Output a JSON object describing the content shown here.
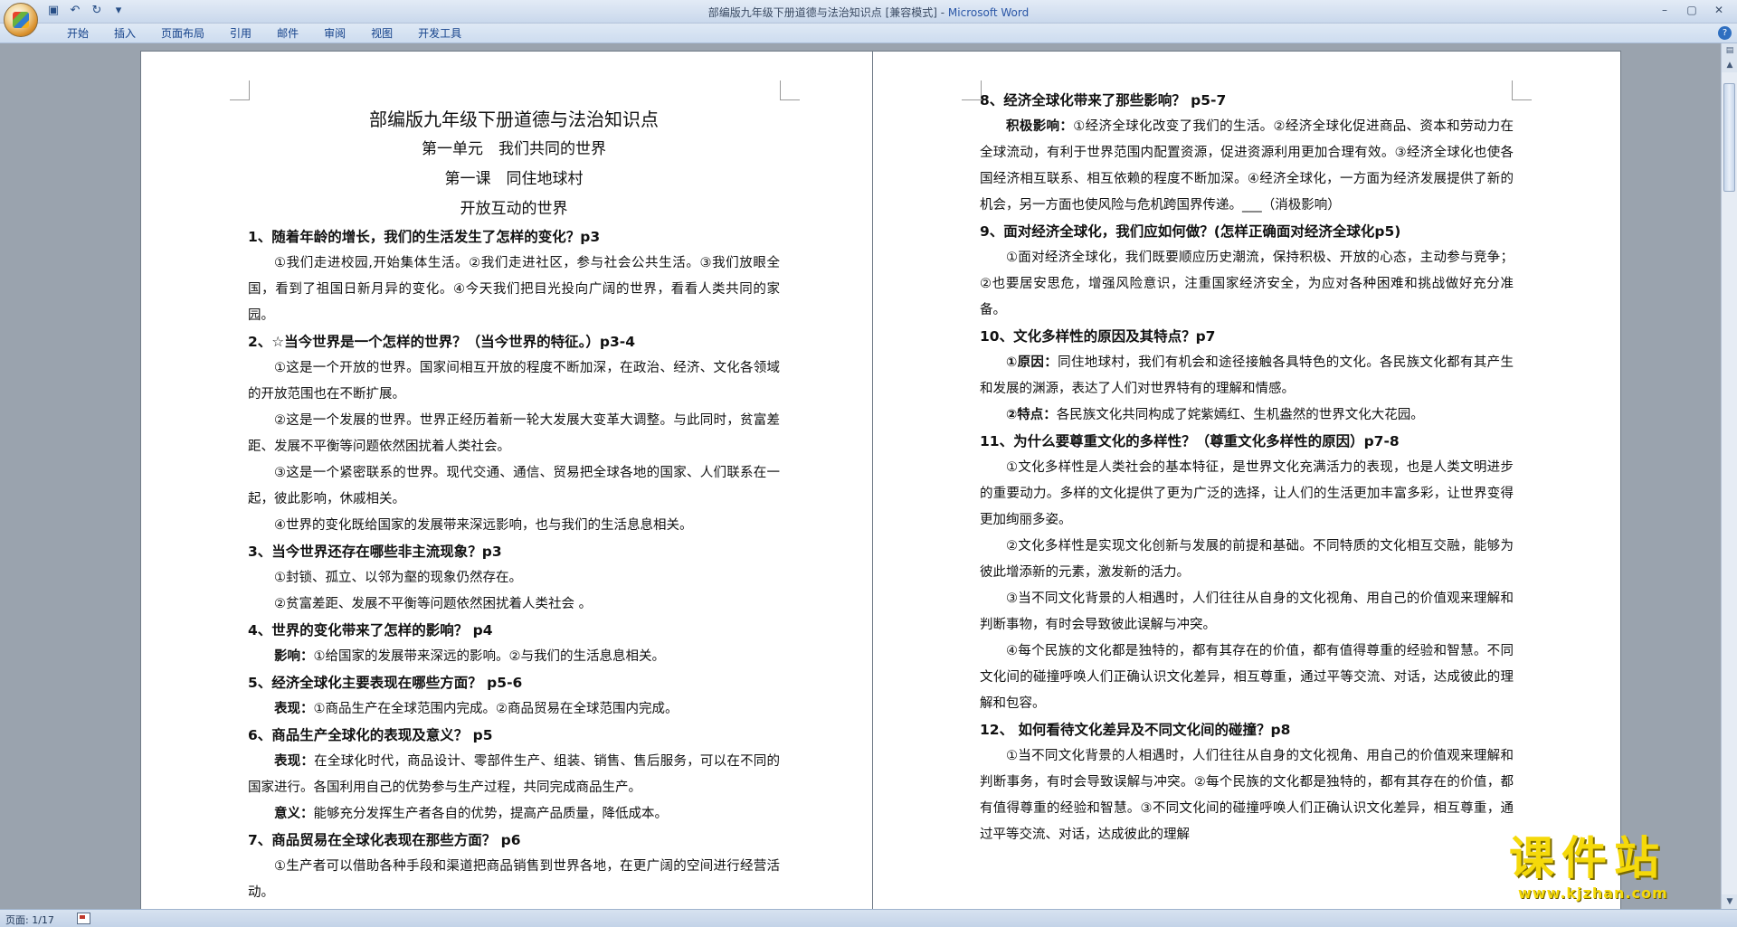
{
  "titlebar": {
    "doc_title": "部编版九年级下册道德与法治知识点 [兼容模式] - ",
    "app_name": "Microsoft Word",
    "qat": [
      "save-icon",
      "undo-icon",
      "redo-icon",
      "customize-icon"
    ],
    "window_controls": [
      "minimize-icon",
      "maximize-icon",
      "close-icon"
    ]
  },
  "ribbon": {
    "tabs": [
      "开始",
      "插入",
      "页面布局",
      "引用",
      "邮件",
      "审阅",
      "视图",
      "开发工具"
    ]
  },
  "left_page": {
    "title": "部编版九年级下册道德与法治知识点",
    "unit": "第一单元　我们共同的世界",
    "lesson": "第一课　同住地球村",
    "section": "开放互动的世界",
    "blocks": [
      {
        "type": "q",
        "text": "1、随着年龄的增长，我们的生活发生了怎样的变化？p3"
      },
      {
        "type": "p",
        "text": "①我们走进校园,开始集体生活。②我们走进社区，参与社会公共生活。③我们放眼全国，看到了祖国日新月异的变化。④今天我们把目光投向广阔的世界，看看人类共同的家园。"
      },
      {
        "type": "q",
        "text": "2、☆当今世界是一个怎样的世界？（当今世界的特征。）p3-4"
      },
      {
        "type": "p",
        "text": "①这是一个开放的世界。国家间相互开放的程度不断加深，在政治、经济、文化各领域的开放范围也在不断扩展。"
      },
      {
        "type": "p",
        "text": "②这是一个发展的世界。世界正经历着新一轮大发展大变革大调整。与此同时，贫富差距、发展不平衡等问题依然困扰着人类社会。"
      },
      {
        "type": "p",
        "text": "③这是一个紧密联系的世界。现代交通、通信、贸易把全球各地的国家、人们联系在一起，彼此影响，休戚相关。"
      },
      {
        "type": "p",
        "text": "④世界的变化既给国家的发展带来深远影响，也与我们的生活息息相关。"
      },
      {
        "type": "q",
        "text": "3、当今世界还存在哪些非主流现象？p3"
      },
      {
        "type": "p",
        "text": "①封锁、孤立、以邻为壑的现象仍然存在。"
      },
      {
        "type": "p",
        "text": "②贫富差距、发展不平衡等问题依然困扰着人类社会 。"
      },
      {
        "type": "q",
        "text": "4、世界的变化带来了怎样的影响？ p4"
      },
      {
        "type": "lp",
        "label": "影响：",
        "text": "①给国家的发展带来深远的影响。②与我们的生活息息相关。"
      },
      {
        "type": "q",
        "text": "5、经济全球化主要表现在哪些方面？ p5-6"
      },
      {
        "type": "lp",
        "label": "表现：",
        "text": "①商品生产在全球范围内完成。②商品贸易在全球范围内完成。"
      },
      {
        "type": "q",
        "text": "6、商品生产全球化的表现及意义？ p5"
      },
      {
        "type": "lp",
        "label": "表现：",
        "text": "在全球化时代，商品设计、零部件生产、组装、销售、售后服务，可以在不同的国家进行。各国利用自己的优势参与生产过程，共同完成商品生产。"
      },
      {
        "type": "lp",
        "label": "意义：",
        "text": "能够充分发挥生产者各自的优势，提高产品质量，降低成本。"
      },
      {
        "type": "q",
        "text": "7、商品贸易在全球化表现在那些方面？ p6"
      },
      {
        "type": "p",
        "text": "①生产者可以借助各种手段和渠道把商品销售到世界各地，在更广阔的空间进行经营活动。"
      }
    ]
  },
  "right_page": {
    "blocks": [
      {
        "type": "q",
        "text": "8、经济全球化带来了那些影响？ p5-7"
      },
      {
        "type": "lp",
        "label": "积极影响：",
        "text": "①经济全球化改变了我们的生活。②经济全球化促进商品、资本和劳动力在全球流动，有利于世界范围内配置资源，促进资源利用更加合理有效。③经济全球化也使各国经济相互联系、相互依赖的程度不断加深。④经济全球化，一方面为经济发展提供了新的机会，另一方面也使风险与危机跨国界传递。___（消极影响）"
      },
      {
        "type": "q",
        "text": "9、面对经济全球化，我们应如何做？(怎样正确面对经济全球化p5)"
      },
      {
        "type": "p",
        "text": "①面对经济全球化，我们既要顺应历史潮流，保持积极、开放的心态，主动参与竞争；②也要居安思危，增强风险意识，注重国家经济安全，为应对各种困难和挑战做好充分准备。"
      },
      {
        "type": "q",
        "text": "10、文化多样性的原因及其特点？p7"
      },
      {
        "type": "lp",
        "label": "①原因：",
        "text": "同住地球村，我们有机会和途径接触各具特色的文化。各民族文化都有其产生和发展的渊源，表达了人们对世界特有的理解和情感。"
      },
      {
        "type": "lp",
        "label": "②特点：",
        "text": "各民族文化共同构成了姹紫嫣红、生机盎然的世界文化大花园。"
      },
      {
        "type": "q",
        "text": "11、为什么要尊重文化的多样性？（尊重文化多样性的原因）p7-8"
      },
      {
        "type": "p",
        "text": "①文化多样性是人类社会的基本特征，是世界文化充满活力的表现，也是人类文明进步的重要动力。多样的文化提供了更为广泛的选择，让人们的生活更加丰富多彩，让世界变得更加绚丽多姿。"
      },
      {
        "type": "p",
        "text": "②文化多样性是实现文化创新与发展的前提和基础。不同特质的文化相互交融，能够为彼此增添新的元素，激发新的活力。"
      },
      {
        "type": "p",
        "text": "③当不同文化背景的人相遇时，人们往往从自身的文化视角、用自己的价值观来理解和判断事物，有时会导致彼此误解与冲突。"
      },
      {
        "type": "p",
        "text": "④每个民族的文化都是独特的，都有其存在的价值，都有值得尊重的经验和智慧。不同文化间的碰撞呼唤人们正确认识文化差异，相互尊重，通过平等交流、对话，达成彼此的理解和包容。"
      },
      {
        "type": "q",
        "text": "12、 如何看待文化差异及不同文化间的碰撞？p8"
      },
      {
        "type": "p",
        "text": "①当不同文化背景的人相遇时，人们往往从自身的文化视角、用自己的价值观来理解和判断事务，有时会导致误解与冲突。②每个民族的文化都是独特的，都有其存在的价值，都有值得尊重的经验和智慧。③不同文化间的碰撞呼唤人们正确认识文化差异，相互尊重，通过平等交流、对话，达成彼此的理解"
      }
    ]
  },
  "statusbar": {
    "page_info": "页面: 1/17"
  },
  "watermark": {
    "text": "课件站",
    "url": "www.kjzhan.com"
  },
  "colors": {
    "accent": "#2a56a6",
    "watermark": "#f5d90a",
    "background": "#9aa3ae"
  }
}
